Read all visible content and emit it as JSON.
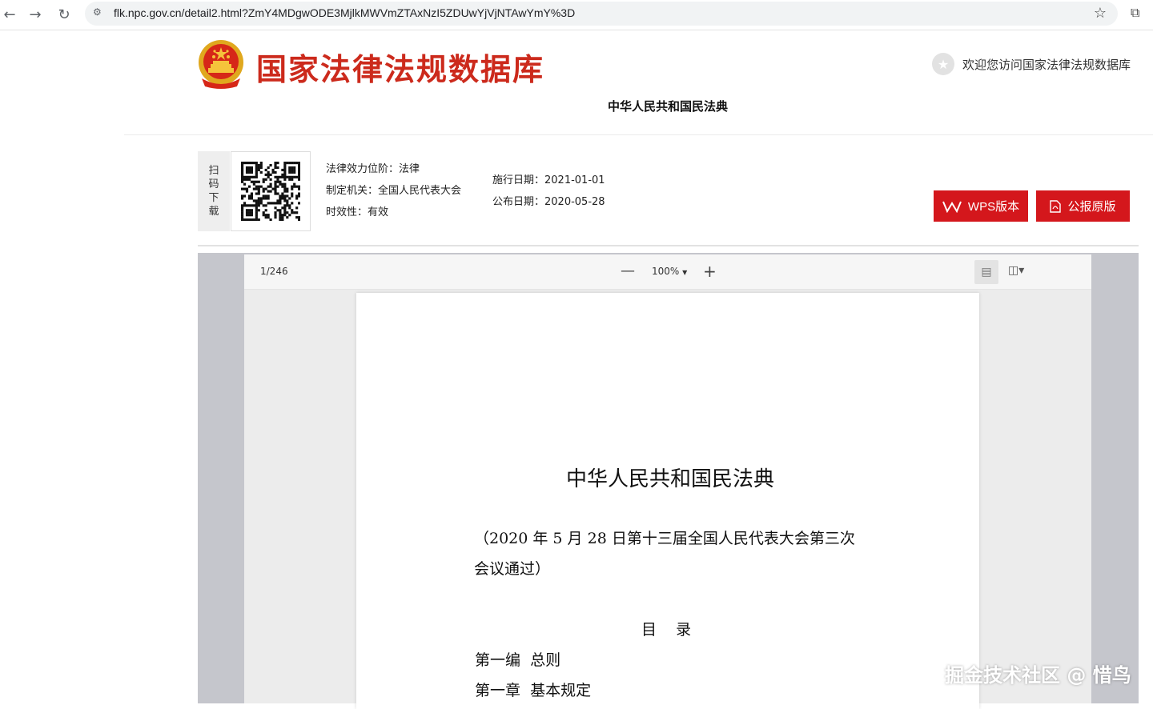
{
  "browser": {
    "url": "flk.npc.gov.cn/detail2.html?ZmY4MDgwODE3MjlkMWVmZTAxNzI5ZDUwYjVjNTAwYmY%3D",
    "back_icon": "arrow-left-icon",
    "forward_icon": "arrow-right-icon",
    "reload_icon": "reload-icon",
    "bookmark_icon": "star-icon"
  },
  "header": {
    "site_title": "国家法律法规数据库",
    "welcome": "欢迎您访问国家法律法规数据库",
    "law_name": "中华人民共和国民法典",
    "brand_color": "#cc2a1c"
  },
  "info": {
    "scan_label": [
      "扫",
      "码",
      "下",
      "载"
    ],
    "legal_rank": "法律效力位阶：法律",
    "issuer": "制定机关：全国人民代表大会",
    "validity": "时效性：有效",
    "effective_date": "施行日期：2021-01-01",
    "publish_date": "公布日期：2020-05-28",
    "wps_button": "WPS版本",
    "pdf_button": "公报原版",
    "button_color": "#d4171c"
  },
  "viewer": {
    "page_indicator": "1/246",
    "zoom_out": "—",
    "zoom_level": "100%",
    "zoom_in": "+"
  },
  "document": {
    "title": "中华人民共和国民法典",
    "adopted_line1": "（2020 年 5 月 28 日第十三届全国人民代表大会第三次",
    "adopted_line2": "会议通过）",
    "toc_heading": "目    录",
    "part_heading": "第一编  总则",
    "chapter_heading": "第一章  基本规定"
  },
  "watermark": "掘金技术社区 @ 惜鸟"
}
